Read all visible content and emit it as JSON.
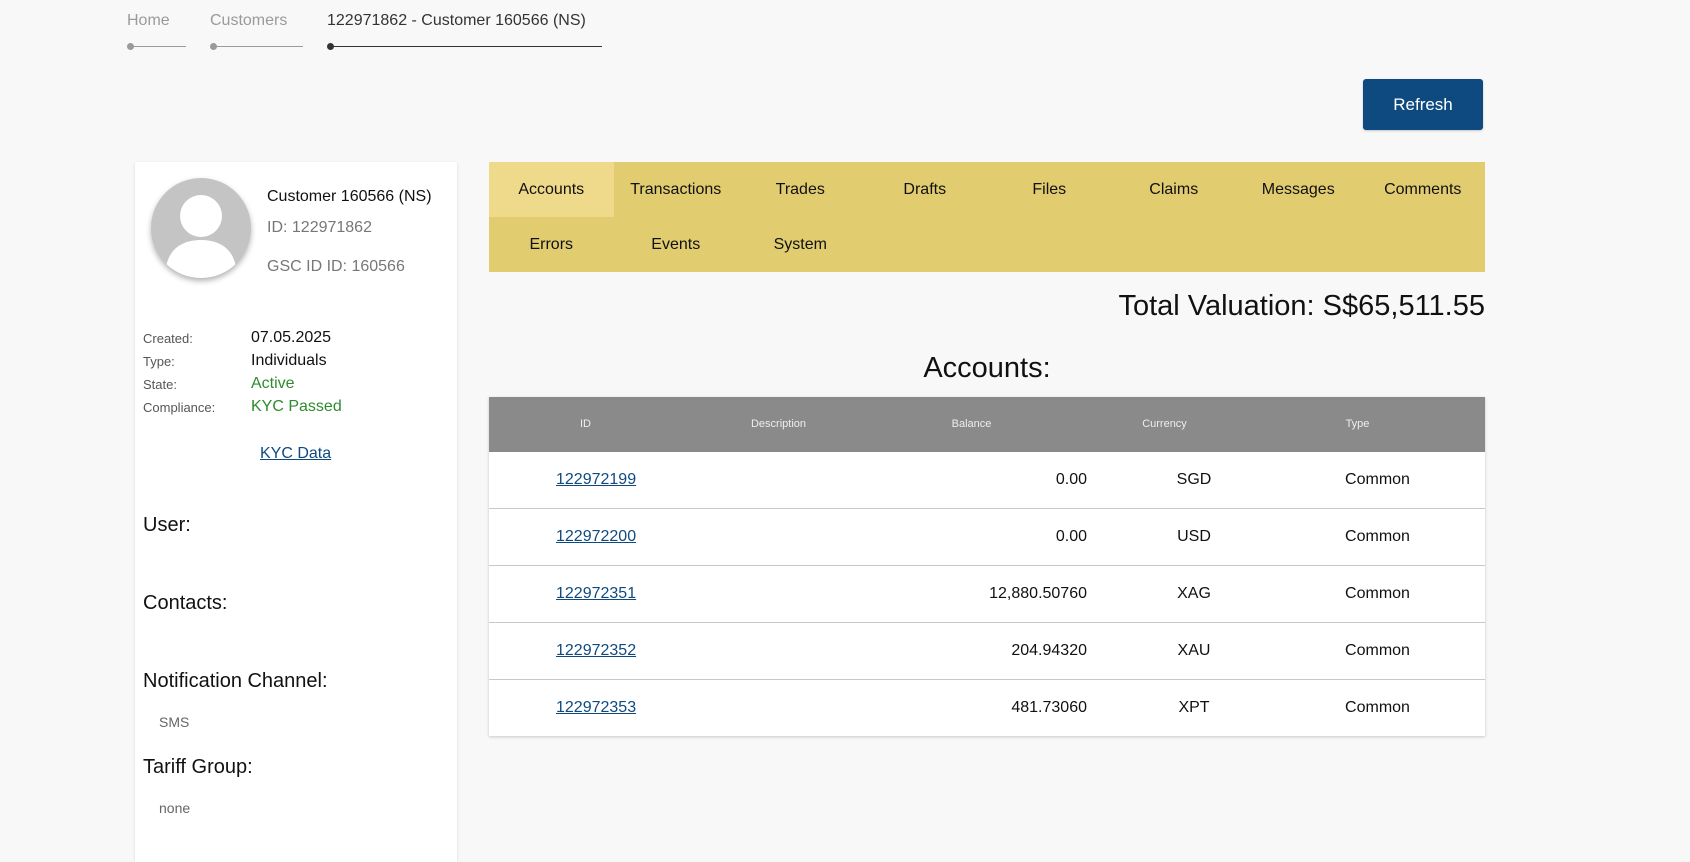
{
  "breadcrumb": {
    "items": [
      {
        "label": "Home"
      },
      {
        "label": "Customers"
      },
      {
        "label": "122971862 - Customer 160566 (NS)"
      }
    ]
  },
  "toolbar": {
    "refresh_label": "Refresh"
  },
  "customer": {
    "name": "Customer 160566 (NS)",
    "id_line": "ID: 122971862",
    "gsc_line": "GSC ID ID: 160566",
    "details": {
      "created_label": "Created:",
      "created_value": "07.05.2025",
      "type_label": "Type:",
      "type_value": "Individuals",
      "state_label": "State:",
      "state_value": "Active",
      "compliance_label": "Compliance:",
      "compliance_value": "KYC Passed"
    },
    "kyc_link": "KYC Data",
    "user_title": "User:",
    "contacts_title": "Contacts:",
    "notification_title": "Notification Channel:",
    "notification_value": "SMS",
    "tariff_title": "Tariff Group:",
    "tariff_value": "none"
  },
  "tabs": [
    {
      "label": "Accounts",
      "active": true
    },
    {
      "label": "Transactions"
    },
    {
      "label": "Trades"
    },
    {
      "label": "Drafts"
    },
    {
      "label": "Files"
    },
    {
      "label": "Claims"
    },
    {
      "label": "Messages"
    },
    {
      "label": "Comments"
    },
    {
      "label": "Errors"
    },
    {
      "label": "Events"
    },
    {
      "label": "System"
    }
  ],
  "valuation": {
    "text": "Total Valuation: S$65,511.55"
  },
  "accounts": {
    "title": "Accounts:",
    "columns": [
      "ID",
      "Description",
      "Balance",
      "Currency",
      "Type"
    ],
    "rows": [
      {
        "id": "122972199",
        "description": "",
        "balance": "0.00",
        "currency": "SGD",
        "type": "Common"
      },
      {
        "id": "122972200",
        "description": "",
        "balance": "0.00",
        "currency": "USD",
        "type": "Common"
      },
      {
        "id": "122972351",
        "description": "",
        "balance": "12,880.50760",
        "currency": "XAG",
        "type": "Common"
      },
      {
        "id": "122972352",
        "description": "",
        "balance": "204.94320",
        "currency": "XAU",
        "type": "Common"
      },
      {
        "id": "122972353",
        "description": "",
        "balance": "481.73060",
        "currency": "XPT",
        "type": "Common"
      }
    ]
  },
  "colors": {
    "primary": "#0e4a80",
    "tab_bar": "#e1cc70",
    "tab_active": "#efd98a",
    "status_green": "#2e8b2e",
    "table_header": "#8a8a8a"
  }
}
